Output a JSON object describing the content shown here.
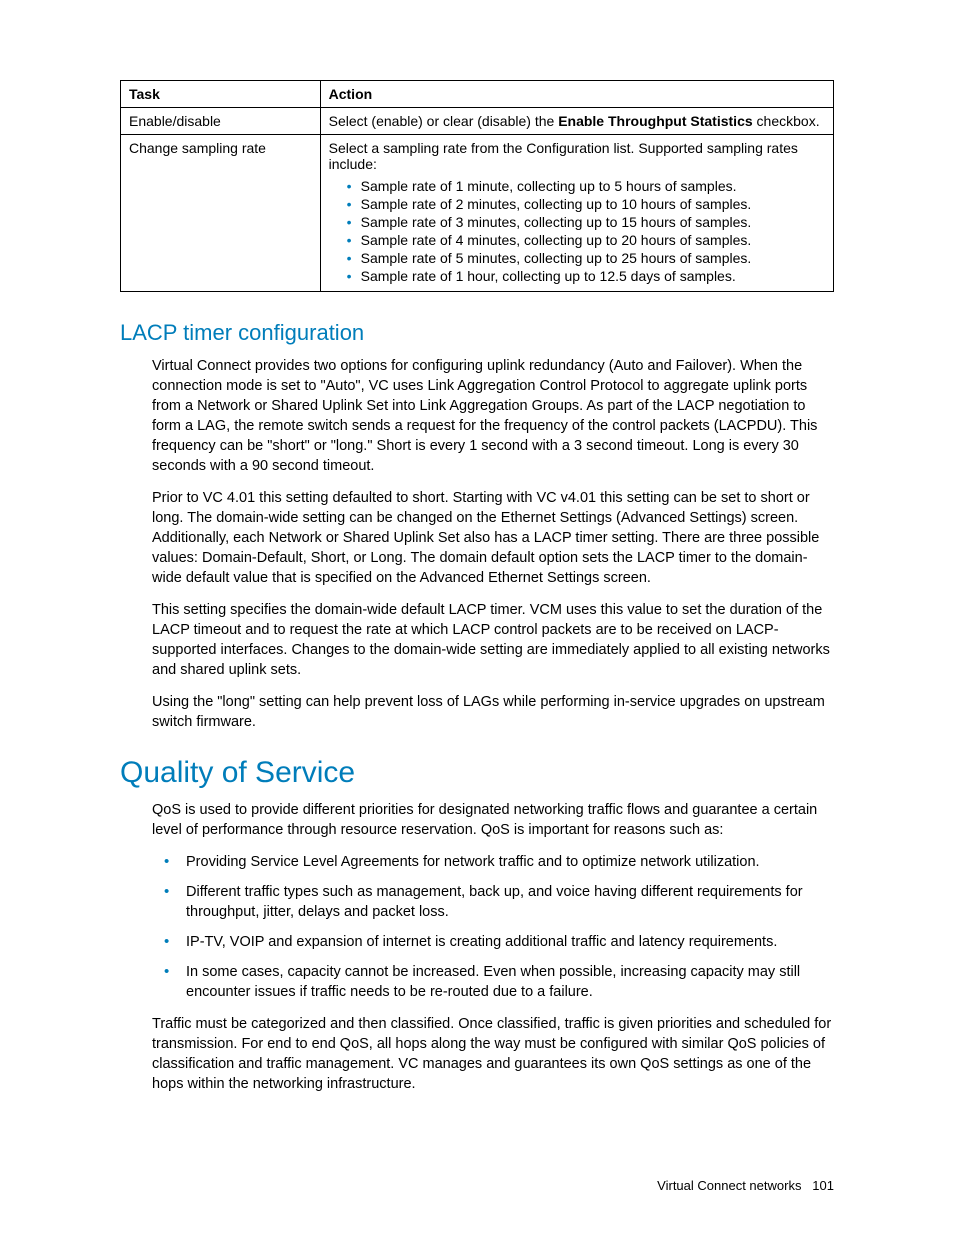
{
  "table": {
    "header": {
      "task": "Task",
      "action": "Action"
    },
    "rows": [
      {
        "task": "Enable/disable",
        "action_pre": "Select (enable) or clear (disable) the ",
        "action_bold": "Enable Throughput Statistics",
        "action_post": " checkbox."
      },
      {
        "task": "Change sampling rate",
        "action_intro": "Select a sampling rate from the Configuration list. Supported sampling rates include:",
        "items": [
          "Sample rate of 1 minute, collecting up to 5 hours of samples.",
          "Sample rate of 2 minutes, collecting up to 10 hours of samples.",
          "Sample rate of 3 minutes, collecting up to 15 hours of samples.",
          "Sample rate of 4 minutes, collecting up to 20 hours of samples.",
          "Sample rate of 5 minutes, collecting up to 25 hours of samples.",
          "Sample rate of 1 hour, collecting up to 12.5 days of samples."
        ]
      }
    ]
  },
  "section_lacp": {
    "heading": "LACP timer configuration",
    "p1": "Virtual Connect provides two options for configuring uplink redundancy (Auto and Failover). When the connection mode is set to \"Auto\", VC uses Link Aggregation Control Protocol to aggregate uplink ports from a Network or Shared Uplink Set into Link Aggregation Groups. As part of the LACP negotiation to form a LAG, the remote switch sends a request for the frequency of the control packets (LACPDU). This frequency can be \"short\" or \"long.\" Short is every 1 second with a 3 second timeout. Long is every 30 seconds with a 90 second timeout.",
    "p2": "Prior to VC 4.01 this setting defaulted to short. Starting with VC v4.01 this setting can be set to short or long. The domain-wide setting can be changed on the Ethernet Settings (Advanced Settings) screen. Additionally, each Network or Shared Uplink Set also has a LACP timer setting. There are three possible values: Domain-Default, Short, or Long. The domain default option sets the LACP timer to the domain-wide default value that is specified on the Advanced Ethernet Settings screen.",
    "p3": "This setting specifies the domain-wide default LACP timer. VCM uses this value to set the duration of the LACP timeout and to request the rate at which LACP control packets are to be received on LACP-supported interfaces. Changes to the domain-wide setting are immediately applied to all existing networks and shared uplink sets.",
    "p4": "Using the \"long\" setting can help prevent loss of LAGs while performing in-service upgrades on upstream switch firmware."
  },
  "section_qos": {
    "heading": "Quality of Service",
    "p1": "QoS is used to provide different priorities for designated networking traffic flows and guarantee a certain level of performance through resource reservation. QoS is important for reasons such as:",
    "bullets": [
      "Providing Service Level Agreements for network traffic and to optimize network utilization.",
      "Different traffic types such as management, back up, and voice having different requirements for throughput, jitter, delays and packet loss.",
      "IP-TV, VOIP and expansion of internet is creating additional traffic and latency requirements.",
      "In some cases, capacity cannot be increased. Even when possible, increasing capacity may still encounter issues if traffic needs to be re-routed due to a failure."
    ],
    "p2": "Traffic must be categorized and then classified. Once classified, traffic is given priorities and scheduled for transmission. For end to end QoS, all hops along the way must be configured with similar QoS policies of classification and traffic management. VC manages and guarantees its own QoS settings as one of the hops within the networking infrastructure."
  },
  "footer": {
    "text": "Virtual Connect networks",
    "page": "101"
  }
}
